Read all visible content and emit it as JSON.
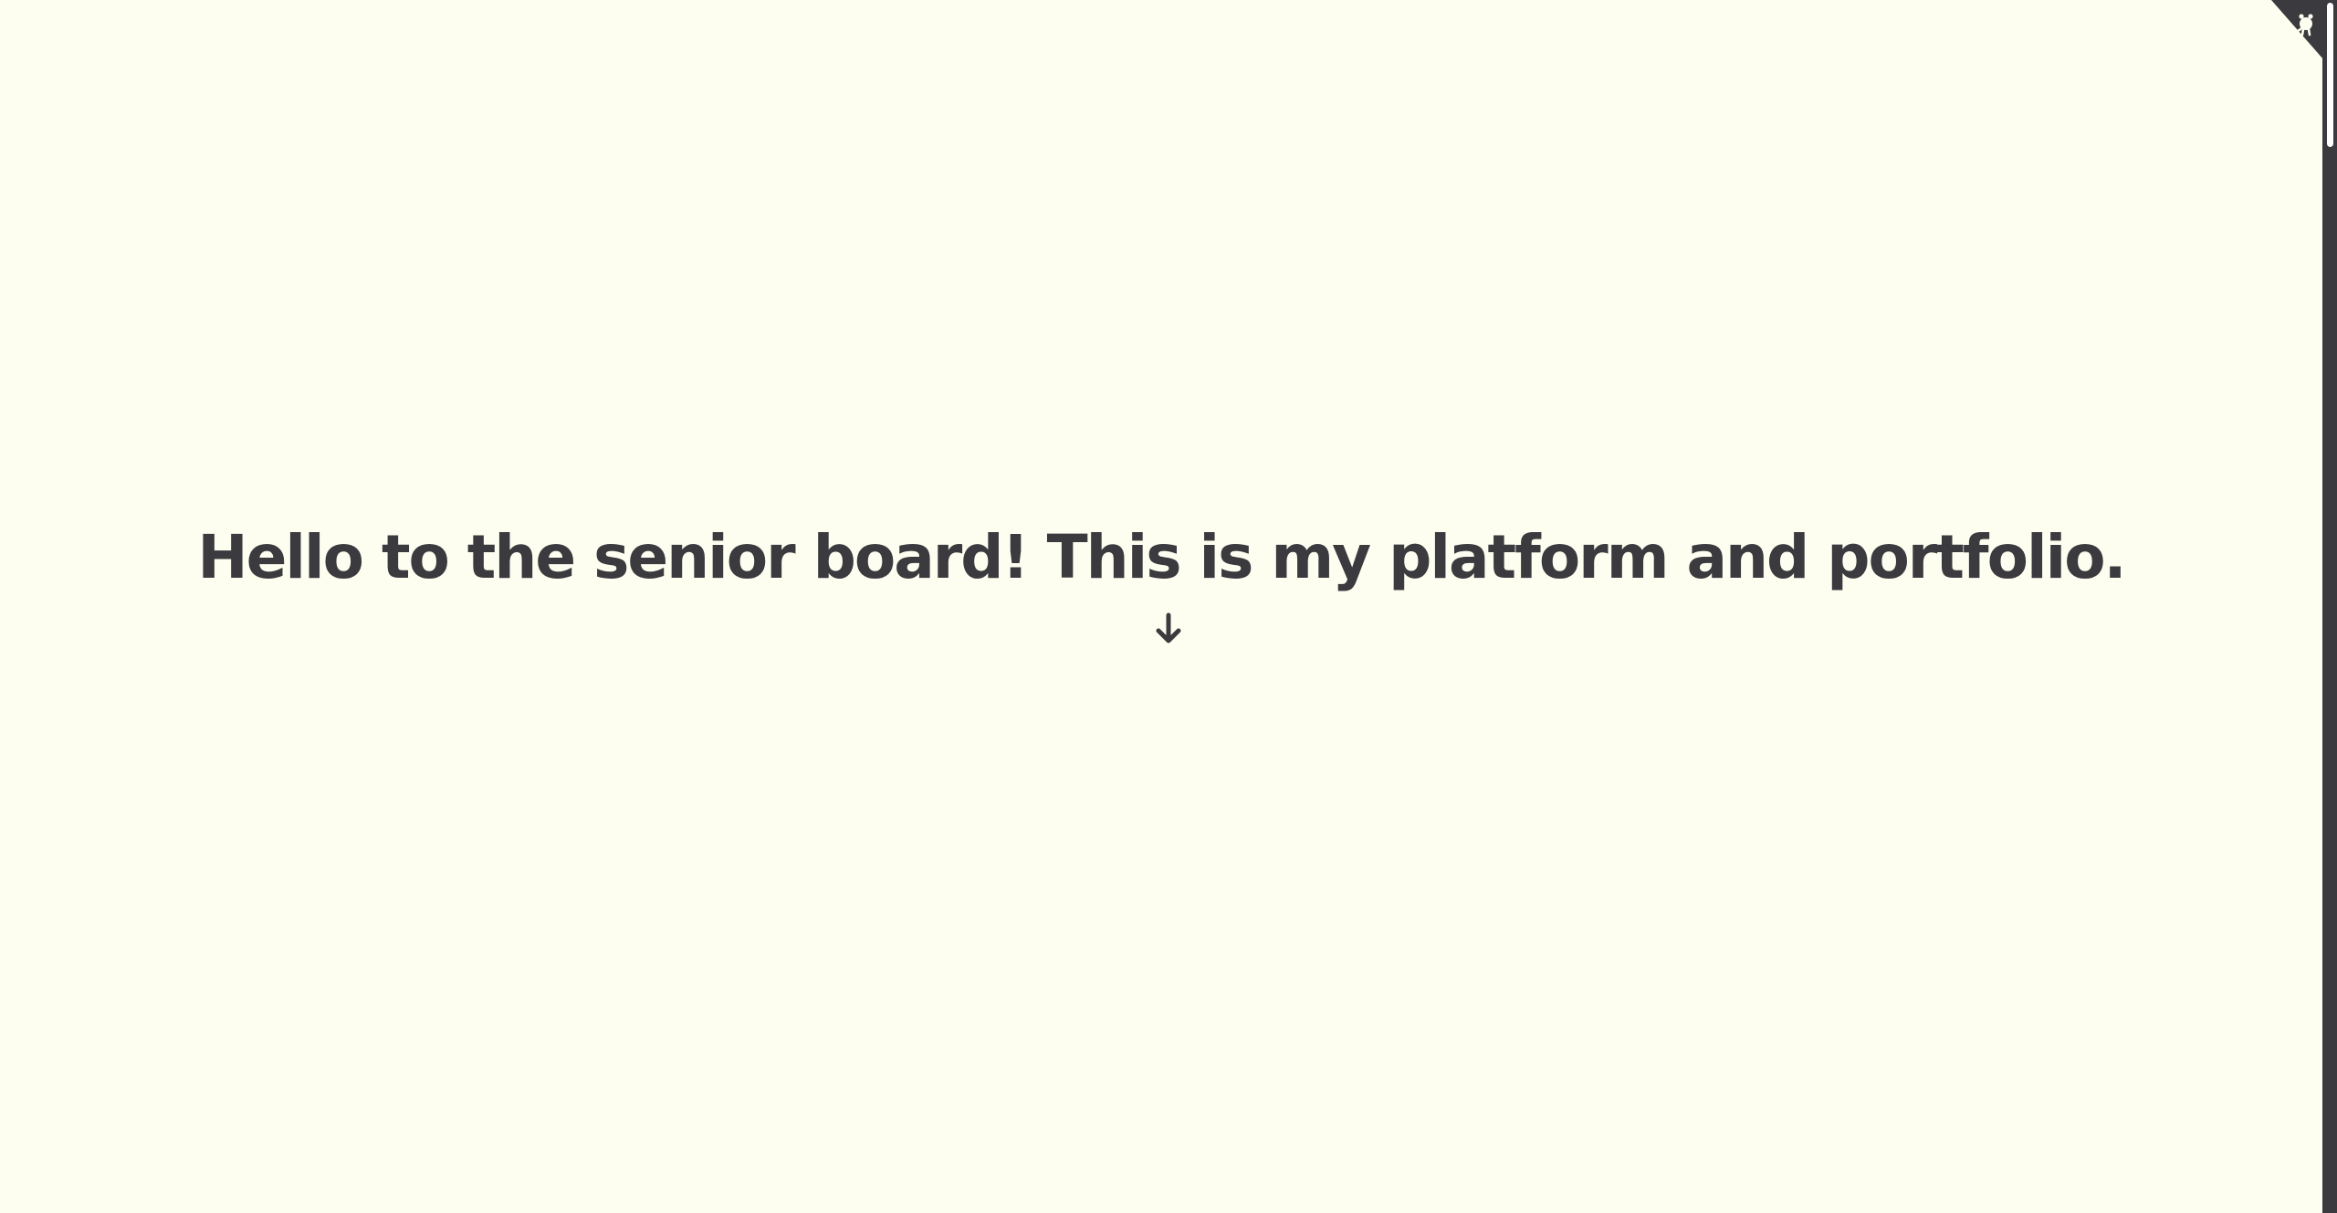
{
  "hero": {
    "title": "Hello to the senior board! This is my platform and portfolio."
  },
  "icons": {
    "scroll_down": "arrow-down-icon",
    "repo_corner": "octocat-icon"
  },
  "colors": {
    "background": "#FEFEF0",
    "text": "#3A3A3F",
    "scrollbar_thumb": "#FFFFFF"
  }
}
